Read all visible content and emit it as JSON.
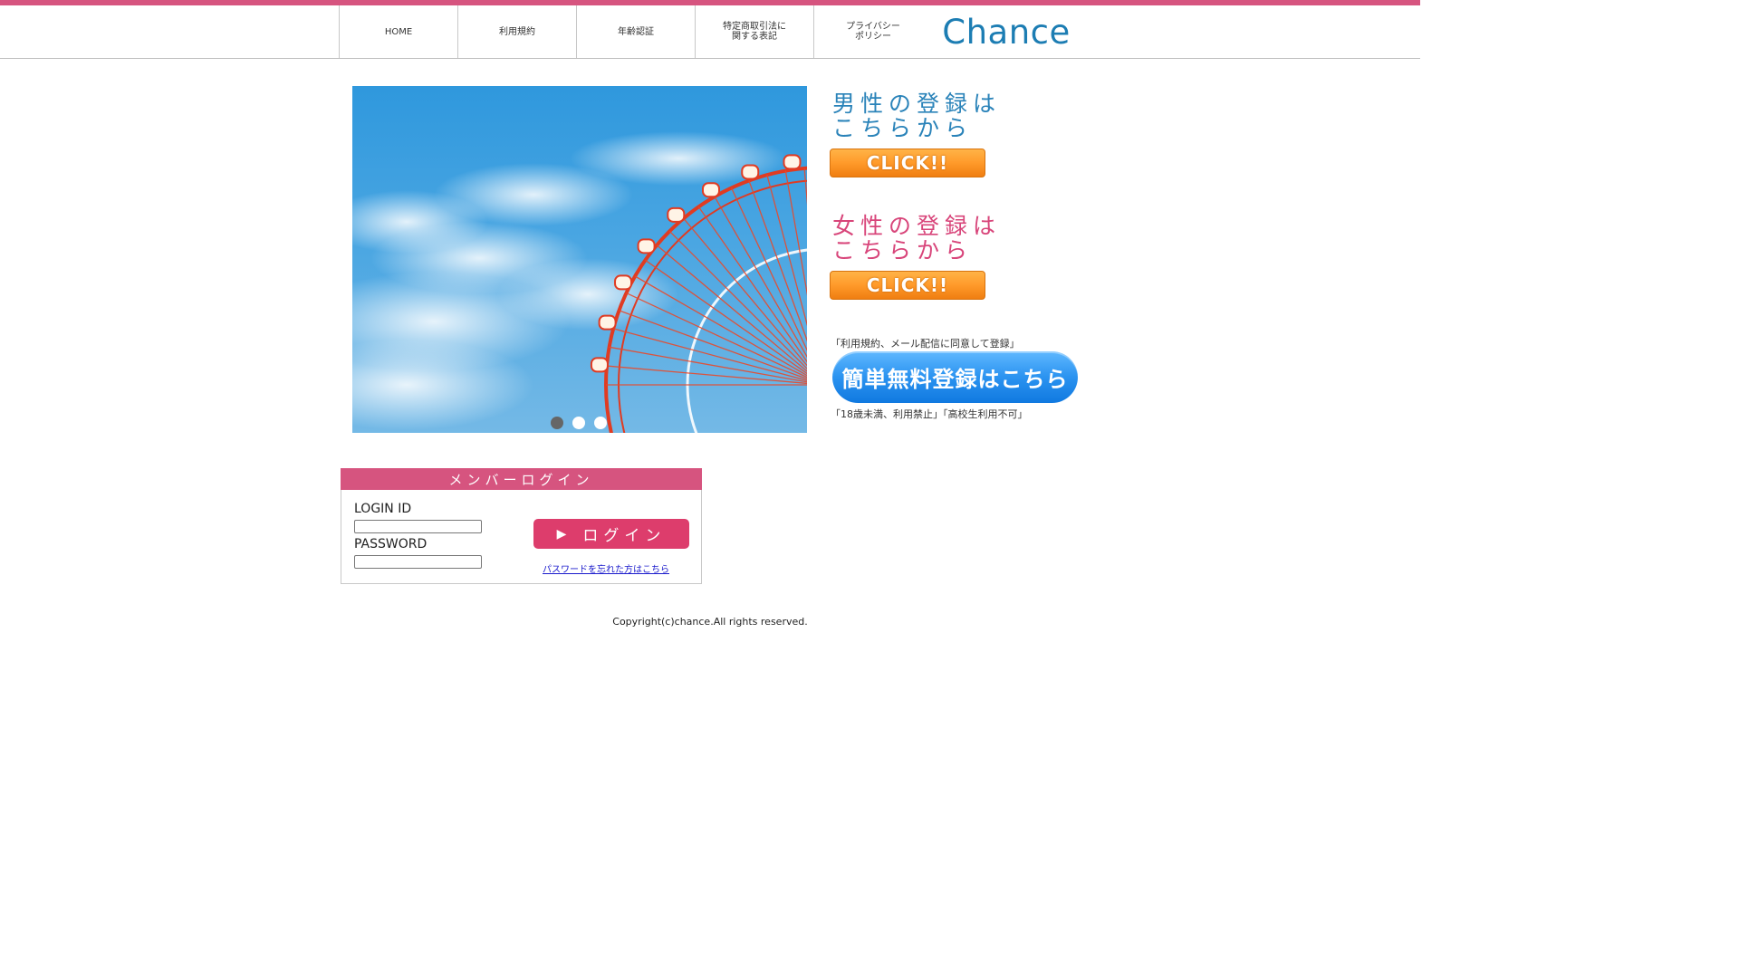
{
  "brand": {
    "logo_text": "Chance",
    "accent_color": "#d6547f",
    "logo_color": "#1c7db3"
  },
  "nav": [
    {
      "label": "HOME"
    },
    {
      "label": "利用規約"
    },
    {
      "label": "年齢認証"
    },
    {
      "label": "特定商取引法に\n関する表記"
    },
    {
      "label": "プライバシー\nポリシー"
    }
  ],
  "slider": {
    "image": "ferris-wheel-blue-sky",
    "slide_count": 3,
    "active_index": 0
  },
  "registration": {
    "male_title": "男性の登録は\nこちらから",
    "male_button": "CLICK!!",
    "female_title": "女性の登録は\nこちらから",
    "female_button": "CLICK!!",
    "agree_note": "「利用規約、メール配信に同意して登録」",
    "free_button": "簡単無料登録はこちら",
    "age_note": "「18歳未満、利用禁止」「高校生利用不可」"
  },
  "login": {
    "heading": "メンバーログイン",
    "id_label": "LOGIN ID",
    "id_value": "",
    "password_label": "PASSWORD",
    "password_value": "",
    "submit_icon": "▶",
    "submit_label": "ログイン",
    "forgot_link": "パスワードを忘れた方はこちら"
  },
  "footer": {
    "copyright": "Copyright(c)chance.All rights reserved."
  }
}
